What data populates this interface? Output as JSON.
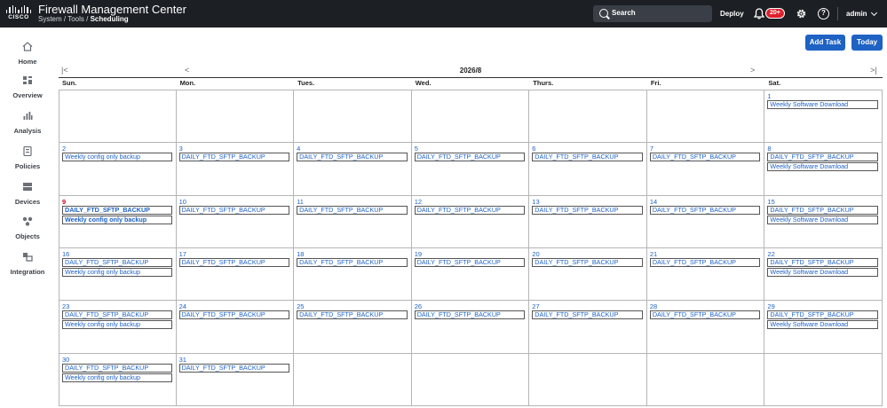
{
  "header": {
    "logo_text": "CISCO",
    "app_title": "Firewall Management Center",
    "breadcrumb": [
      "System",
      "Tools",
      "Scheduling"
    ],
    "breadcrumb_sep": " / ",
    "search_label": "Search",
    "deploy_label": "Deploy",
    "notifications_badge": "20+",
    "user": "admin"
  },
  "sidebar": {
    "items": [
      {
        "label": "Home",
        "icon": "home-icon"
      },
      {
        "label": "Overview",
        "icon": "overview-icon"
      },
      {
        "label": "Analysis",
        "icon": "analysis-icon"
      },
      {
        "label": "Policies",
        "icon": "policies-icon"
      },
      {
        "label": "Devices",
        "icon": "devices-icon"
      },
      {
        "label": "Objects",
        "icon": "objects-icon"
      },
      {
        "label": "Integration",
        "icon": "integration-icon"
      }
    ]
  },
  "toolbar": {
    "add_task_label": "Add Task",
    "today_label": "Today"
  },
  "calendar": {
    "month_label": "2026/8",
    "prev_year": "|<",
    "prev_month": "<",
    "next_month": ">",
    "next_year": ">|",
    "weekdays": [
      "Sun.",
      "Mon.",
      "Tues.",
      "Wed.",
      "Thurs.",
      "Fri.",
      "Sat."
    ],
    "weeks": [
      [
        {
          "day": "",
          "events": []
        },
        {
          "day": "",
          "events": []
        },
        {
          "day": "",
          "events": []
        },
        {
          "day": "",
          "events": []
        },
        {
          "day": "",
          "events": []
        },
        {
          "day": "",
          "events": []
        },
        {
          "day": "1",
          "events": [
            "Weekly Software Download"
          ]
        }
      ],
      [
        {
          "day": "2",
          "events": [
            "Weekly config only backup"
          ]
        },
        {
          "day": "3",
          "events": [
            "DAILY_FTD_SFTP_BACKUP"
          ]
        },
        {
          "day": "4",
          "events": [
            "DAILY_FTD_SFTP_BACKUP"
          ]
        },
        {
          "day": "5",
          "events": [
            "DAILY_FTD_SFTP_BACKUP"
          ]
        },
        {
          "day": "6",
          "events": [
            "DAILY_FTD_SFTP_BACKUP"
          ]
        },
        {
          "day": "7",
          "events": [
            "DAILY_FTD_SFTP_BACKUP"
          ]
        },
        {
          "day": "8",
          "events": [
            "DAILY_FTD_SFTP_BACKUP",
            "Weekly Software Download"
          ]
        }
      ],
      [
        {
          "day": "9",
          "today": true,
          "events": [
            "DAILY_FTD_SFTP_BACKUP",
            "Weekly config only backup"
          ]
        },
        {
          "day": "10",
          "events": [
            "DAILY_FTD_SFTP_BACKUP"
          ]
        },
        {
          "day": "11",
          "events": [
            "DAILY_FTD_SFTP_BACKUP"
          ]
        },
        {
          "day": "12",
          "events": [
            "DAILY_FTD_SFTP_BACKUP"
          ]
        },
        {
          "day": "13",
          "events": [
            "DAILY_FTD_SFTP_BACKUP"
          ]
        },
        {
          "day": "14",
          "events": [
            "DAILY_FTD_SFTP_BACKUP"
          ]
        },
        {
          "day": "15",
          "events": [
            "DAILY_FTD_SFTP_BACKUP",
            "Weekly Software Download"
          ]
        }
      ],
      [
        {
          "day": "16",
          "events": [
            "DAILY_FTD_SFTP_BACKUP",
            "Weekly config only backup"
          ]
        },
        {
          "day": "17",
          "events": [
            "DAILY_FTD_SFTP_BACKUP"
          ]
        },
        {
          "day": "18",
          "events": [
            "DAILY_FTD_SFTP_BACKUP"
          ]
        },
        {
          "day": "19",
          "events": [
            "DAILY_FTD_SFTP_BACKUP"
          ]
        },
        {
          "day": "20",
          "events": [
            "DAILY_FTD_SFTP_BACKUP"
          ]
        },
        {
          "day": "21",
          "events": [
            "DAILY_FTD_SFTP_BACKUP"
          ]
        },
        {
          "day": "22",
          "events": [
            "DAILY_FTD_SFTP_BACKUP",
            "Weekly Software Download"
          ]
        }
      ],
      [
        {
          "day": "23",
          "events": [
            "DAILY_FTD_SFTP_BACKUP",
            "Weekly config only backup"
          ]
        },
        {
          "day": "24",
          "events": [
            "DAILY_FTD_SFTP_BACKUP"
          ]
        },
        {
          "day": "25",
          "events": [
            "DAILY_FTD_SFTP_BACKUP"
          ]
        },
        {
          "day": "26",
          "events": [
            "DAILY_FTD_SFTP_BACKUP"
          ]
        },
        {
          "day": "27",
          "events": [
            "DAILY_FTD_SFTP_BACKUP"
          ]
        },
        {
          "day": "28",
          "events": [
            "DAILY_FTD_SFTP_BACKUP"
          ]
        },
        {
          "day": "29",
          "events": [
            "DAILY_FTD_SFTP_BACKUP",
            "Weekly Software Download"
          ]
        }
      ],
      [
        {
          "day": "30",
          "events": [
            "DAILY_FTD_SFTP_BACKUP",
            "Weekly config only backup"
          ]
        },
        {
          "day": "31",
          "events": [
            "DAILY_FTD_SFTP_BACKUP"
          ]
        },
        {
          "day": "",
          "events": []
        },
        {
          "day": "",
          "events": []
        },
        {
          "day": "",
          "events": []
        },
        {
          "day": "",
          "events": []
        },
        {
          "day": "",
          "events": []
        }
      ]
    ]
  },
  "colors": {
    "topbar": "#1c1f24",
    "accent": "#1e62c4",
    "today": "#d0021b",
    "badge": "#e0202c"
  }
}
